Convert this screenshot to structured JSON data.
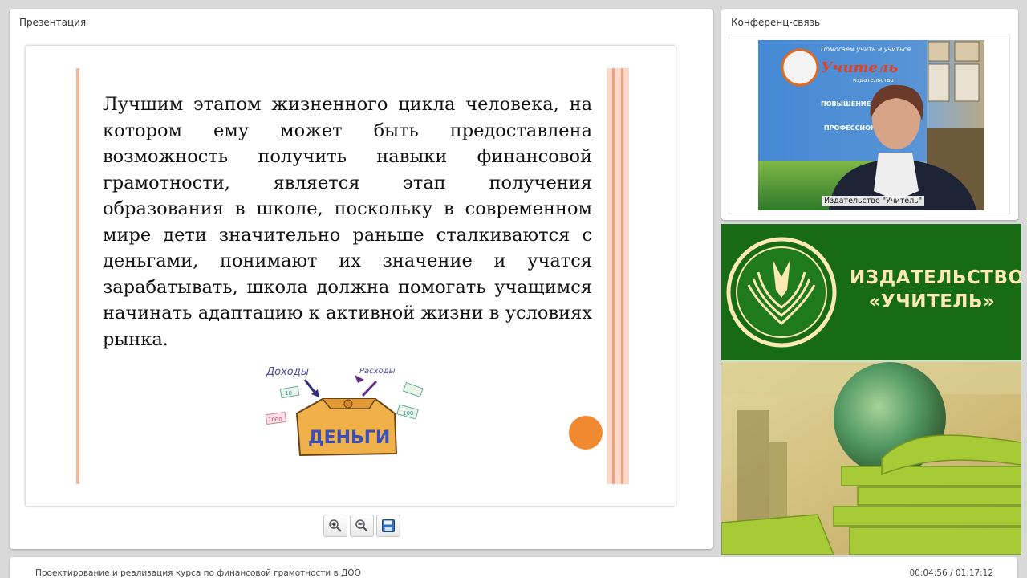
{
  "presentation": {
    "title": "Презентация",
    "slide": {
      "text": "Лучшим этапом жизненного цикла человека, на котором ему может быть предоставлена возможность получить навыки финансовой грамотности, является этап получения образования в школе, поскольку в современном мире дети значительно раньше сталкиваются с деньгами, понимают их значение и учатся зарабатывать, школа должна помогать учащимся начинать адаптацию к активной жизни в условиях рынка.",
      "illustration": {
        "income_label": "Доходы",
        "expenses_label": "Расходы",
        "money_label": "ДЕНЬГИ",
        "notes": [
          "10",
          "1000",
          "100"
        ]
      },
      "accent_color": "#f0892f"
    },
    "toolbar": {
      "zoom_in_icon": "zoom-in-icon",
      "zoom_out_icon": "zoom-out-icon",
      "save_icon": "save-icon"
    }
  },
  "conference": {
    "title": "Конференц-связь",
    "video_caption": "Издательство \"Учитель\"",
    "backdrop": {
      "line1": "Помогаем учить и учиться",
      "brand": "Учитель",
      "sub": "издательство",
      "item1": "ПОВЫШЕНИЕ КВАЛИФИ",
      "item2": "ПРОФЕССИОН ПЕРЕПОДГ"
    }
  },
  "banner": {
    "line1": "ИЗДАТЕЛЬСТВО",
    "line2": "«УЧИТЕЛЬ»",
    "color": "#176b15"
  },
  "footer": {
    "course_title": "Проектирование и реализация курса по финансовой грамотности в ДОО",
    "time": "00:04:56 / 01:17:12"
  }
}
